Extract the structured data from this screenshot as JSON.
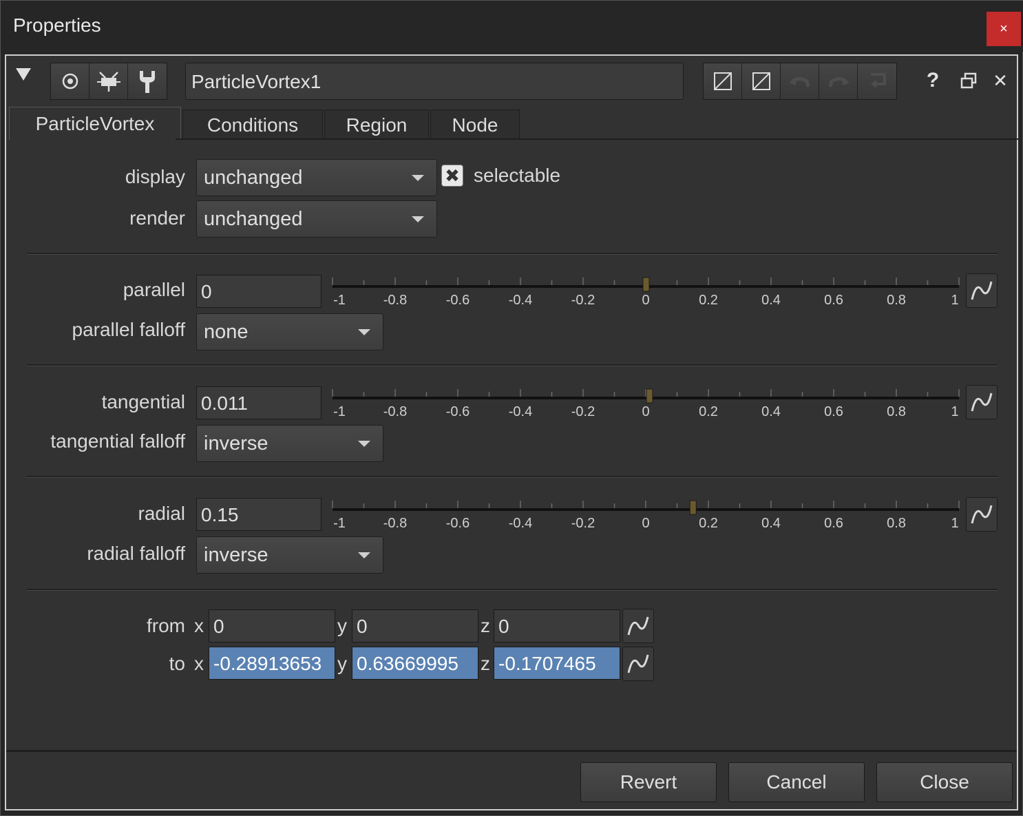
{
  "window": {
    "title": "Properties",
    "close_glyph": "×"
  },
  "header": {
    "node_name": "ParticleVortex1",
    "help_glyph": "?",
    "close_glyph": "✕"
  },
  "tabs": [
    {
      "label": "ParticleVortex",
      "active": true
    },
    {
      "label": "Conditions",
      "active": false
    },
    {
      "label": "Region",
      "active": false
    },
    {
      "label": "Node",
      "active": false
    }
  ],
  "display": {
    "label": "display",
    "value": "unchanged"
  },
  "selectable": {
    "label": "selectable",
    "checked": true,
    "glyph": "✖"
  },
  "render": {
    "label": "render",
    "value": "unchanged"
  },
  "slider_ticks": [
    "-1",
    "-0.8",
    "-0.6",
    "-0.4",
    "-0.2",
    "0",
    "0.2",
    "0.4",
    "0.6",
    "0.8",
    "1"
  ],
  "slider_range": [
    -1,
    1
  ],
  "parallel": {
    "label": "parallel",
    "value": "0",
    "slider": 0.0
  },
  "parallel_falloff": {
    "label": "parallel falloff",
    "value": "none"
  },
  "tangential": {
    "label": "tangential",
    "value": "0.011",
    "slider": 0.011
  },
  "tangential_falloff": {
    "label": "tangential falloff",
    "value": "inverse"
  },
  "radial": {
    "label": "radial",
    "value": "0.15",
    "slider": 0.15
  },
  "radial_falloff": {
    "label": "radial falloff",
    "value": "inverse"
  },
  "from": {
    "label": "from",
    "x_label": "x",
    "y_label": "y",
    "z_label": "z",
    "x": "0",
    "y": "0",
    "z": "0"
  },
  "to": {
    "label": "to",
    "x_label": "x",
    "y_label": "y",
    "z_label": "z",
    "x": "-0.28913653",
    "y": "0.63669995",
    "z": "-0.1707465"
  },
  "footer": {
    "revert": "Revert",
    "cancel": "Cancel",
    "close": "Close"
  },
  "colors": {
    "accent_selection": "#5a82b2",
    "slider_handle": "#6b5a2e",
    "close_red": "#c42b2b"
  }
}
